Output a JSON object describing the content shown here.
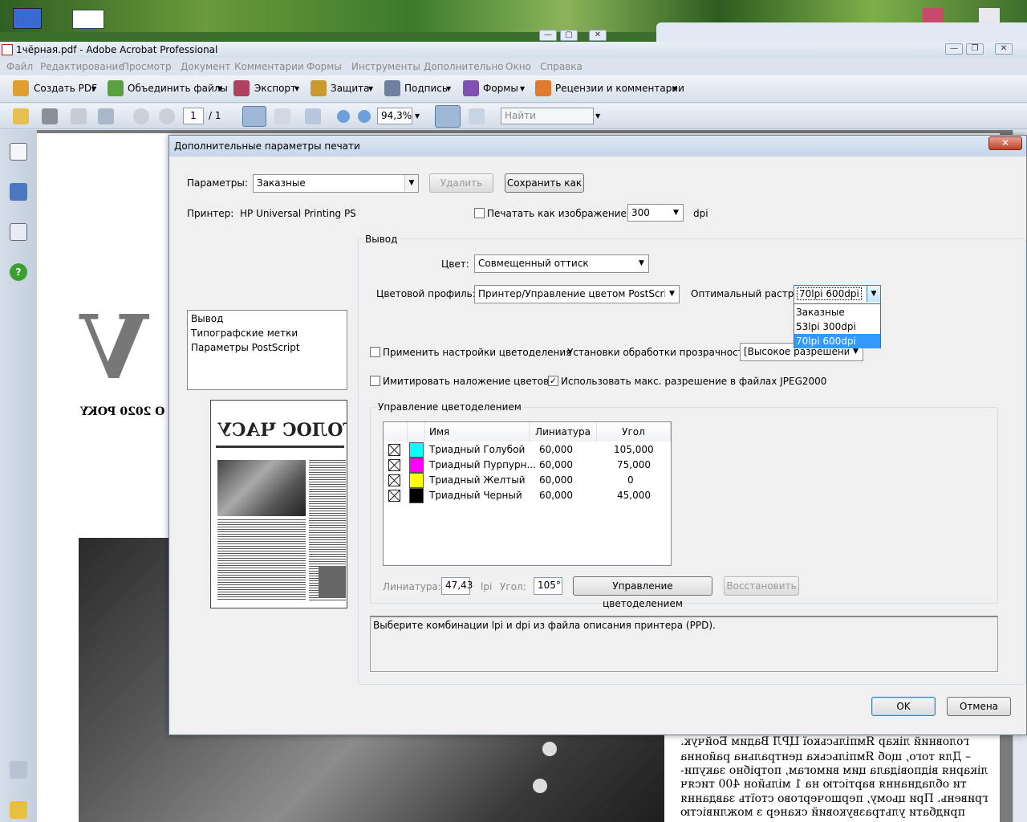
{
  "acrobat": {
    "title": "1чёрная.pdf - Adobe Acrobat Professional",
    "menu": [
      "Файл",
      "Редактирование",
      "Просмотр",
      "Документ",
      "Комментарии",
      "Формы",
      "Инструменты",
      "Дополнительно",
      "Окно",
      "Справка"
    ],
    "toolbar1": [
      "Создать PDF",
      "Объединить файлы",
      "Экспорт",
      "Защита",
      "Подпись",
      "Формы",
      "Рецензии и комментарии"
    ],
    "page_current": "1",
    "page_total": "/ 1",
    "zoom": "94,3%",
    "find_placeholder": "Найти"
  },
  "document": {
    "big_letter": "V",
    "year_line": "O 2020 POKY",
    "article_lines": [
      "головний лікар Ямпільської ЦРЛ Вадим Бойчук.",
      "– Для того, щоб Ямпільська центральна районна",
      "лікарня відповідала цим вимогам, потрібно закупи-",
      "ти обладнання вартістю на 1 мільйон 400 тисяч",
      "гривень. При цьому, першочергово стоїть завдання",
      "придбати ультразвуковий сканер з можливістю"
    ],
    "preview_heading": "ГОЛОС ЧАСУ"
  },
  "dialog": {
    "title": "Дополнительные параметры печати",
    "params_label": "Параметры:",
    "params_value": "Заказные",
    "delete_btn": "Удалить",
    "save_as_btn": "Сохранить как",
    "printer_label": "Принтер:",
    "printer_value": "HP Universal Printing PS",
    "print_as_image_label": "Печатать как изображение",
    "dpi_value": "300",
    "dpi_unit": "dpi",
    "sections": [
      "Вывод",
      "Типографские метки",
      "Параметры PostScript"
    ],
    "output_group": "Вывод",
    "color_label": "Цвет:",
    "color_value": "Совмещенный оттиск",
    "profile_label": "Цветовой профиль:",
    "profile_value": "Принтер/Управление цветом PostScript",
    "raster_label": "Оптимальный растр:",
    "raster_value": "70lpi 600dpi",
    "raster_options": [
      "Заказные",
      "53lpi 300dpi",
      "70lpi 600dpi"
    ],
    "raster_selected_index": 2,
    "apply_sep_label": "Применить настройки цветоделения",
    "transparency_label": "Установки обработки прозрачности:",
    "transparency_value": "[Высокое разрешение]",
    "overprint_label": "Имитировать наложение цветов",
    "jpeg2000_label": "Использовать макс. разрешение в файлах JPEG2000",
    "jpeg2000_checked": true,
    "sep_group": "Управление цветоделением",
    "table_headers": [
      "Имя",
      "Линиатура",
      "Угол"
    ],
    "inks": [
      {
        "name": "Триадный Голубой",
        "lpi": "60,000",
        "angle": "105,000",
        "color": "#00ffff"
      },
      {
        "name": "Триадный Пурпурн...",
        "lpi": "60,000",
        "angle": "75,000",
        "color": "#ff00ff"
      },
      {
        "name": "Триадный Желтый",
        "lpi": "60,000",
        "angle": "0",
        "color": "#ffff00"
      },
      {
        "name": "Триадный Черный",
        "lpi": "60,000",
        "angle": "45,000",
        "color": "#000000"
      }
    ],
    "lineature_label": "Линиатура:",
    "lineature_value": "47,43",
    "lpi_unit": "lpi",
    "angle_label": "Угол:",
    "angle_value": "105°",
    "sep_manage_btn": "Управление цветоделением",
    "restore_btn": "Восстановить",
    "info_text": "Выберите комбинации lpi и dpi из файла описания принтера (PPD).",
    "ok_btn": "OK",
    "cancel_btn": "Отмена"
  }
}
